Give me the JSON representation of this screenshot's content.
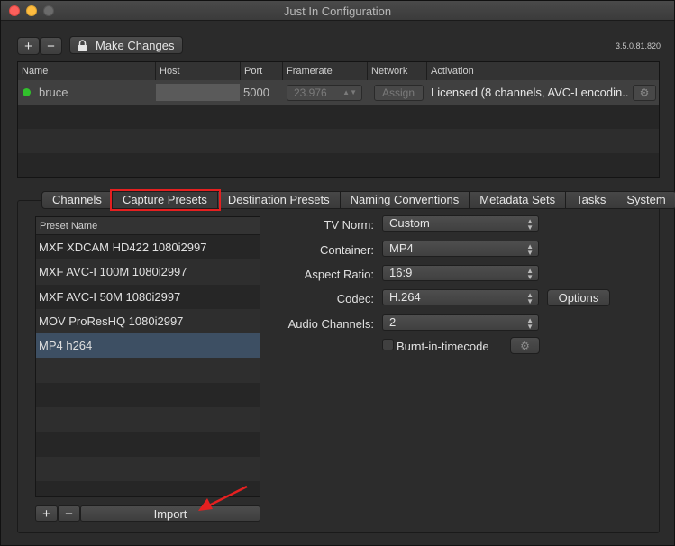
{
  "window": {
    "title": "Just In Configuration",
    "version": "3.5.0.81.820"
  },
  "toolbar": {
    "add": "+",
    "remove": "−",
    "make_changes": "Make Changes"
  },
  "channels_table": {
    "columns": [
      "Name",
      "Host",
      "Port",
      "Framerate",
      "Network",
      "Activation"
    ],
    "rows": [
      {
        "status_color": "#31c12c",
        "name": "bruce",
        "host": "",
        "port": "5000",
        "framerate": "23.976",
        "network": "Assign",
        "activation": "Licensed (8 channels, AVC-I encodin..."
      }
    ]
  },
  "tabs": [
    "Channels",
    "Capture Presets",
    "Destination Presets",
    "Naming Conventions",
    "Metadata Sets",
    "Tasks",
    "System"
  ],
  "selected_tab": "Capture Presets",
  "presets": {
    "header": "Preset Name",
    "items": [
      "MXF XDCAM HD422 1080i2997",
      "MXF AVC-I 100M 1080i2997",
      "MXF AVC-I 50M 1080i2997",
      "MOV ProResHQ 1080i2997",
      "MP4 h264"
    ],
    "selected": "MP4 h264",
    "add": "+",
    "remove": "−",
    "import": "Import"
  },
  "form": {
    "tv_norm": {
      "label": "TV Norm:",
      "value": "Custom"
    },
    "container": {
      "label": "Container:",
      "value": "MP4"
    },
    "aspect_ratio": {
      "label": "Aspect Ratio:",
      "value": "16:9"
    },
    "codec": {
      "label": "Codec:",
      "value": "H.264",
      "options_button": "Options"
    },
    "audio_channels": {
      "label": "Audio Channels:",
      "value": "2"
    },
    "burnin": {
      "label": "Burnt-in-timecode",
      "checked": false
    }
  },
  "colors": {
    "annotation": "#e52020",
    "selection": "#3d4f63"
  }
}
